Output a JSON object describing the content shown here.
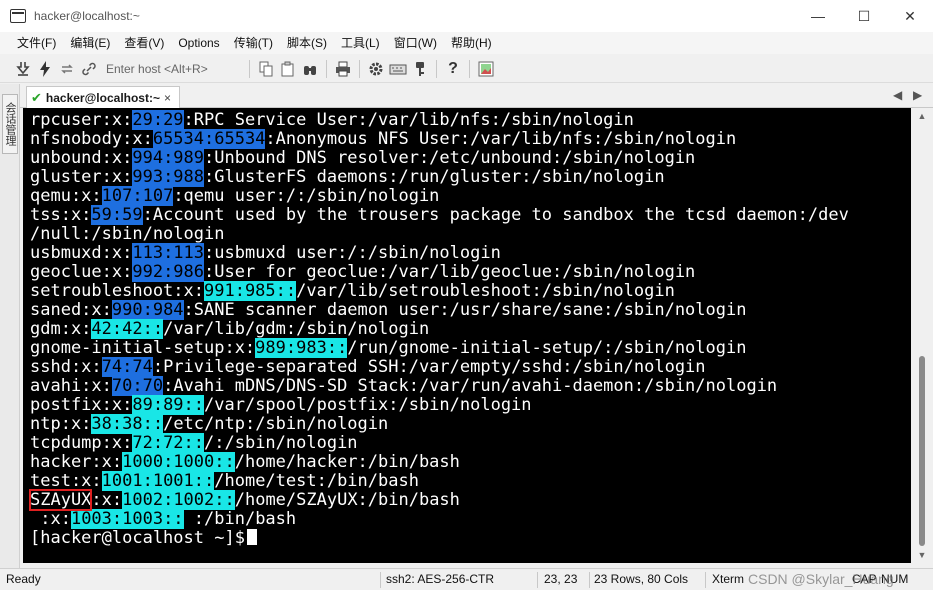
{
  "window": {
    "title": "hacker@localhost:~",
    "controls": {
      "minimize": "—",
      "maximize": "☐",
      "close": "✕"
    }
  },
  "menu": {
    "items": [
      "文件(F)",
      "编辑(E)",
      "查看(V)",
      "Options",
      "传输(T)",
      "脚本(S)",
      "工具(L)",
      "窗口(W)",
      "帮助(H)"
    ]
  },
  "toolbar": {
    "host_placeholder": "Enter host <Alt+R>",
    "icons": [
      "connect-icon",
      "lightning-icon",
      "reconnect-icon",
      "link-icon",
      "copy-icon",
      "paste-icon",
      "find-icon",
      "print-icon",
      "settings-icon",
      "keymap-icon",
      "key-icon",
      "help-icon",
      "image-icon"
    ]
  },
  "side_panel": {
    "label": "会话管理"
  },
  "tab": {
    "label": "hacker@localhost:~",
    "close": "×"
  },
  "terminal": {
    "lines": [
      [
        {
          "t": "rpcuser:x:"
        },
        {
          "t": "29:29",
          "h": "blue"
        },
        {
          "t": ":RPC Service User:/var/lib/nfs:/sbin/nologin"
        }
      ],
      [
        {
          "t": "nfsnobody:x:"
        },
        {
          "t": "65534:65534",
          "h": "blue"
        },
        {
          "t": ":Anonymous NFS User:/var/lib/nfs:/sbin/nologin"
        }
      ],
      [
        {
          "t": "unbound:x:"
        },
        {
          "t": "994:989",
          "h": "blue"
        },
        {
          "t": ":Unbound DNS resolver:/etc/unbound:/sbin/nologin"
        }
      ],
      [
        {
          "t": "gluster:x:"
        },
        {
          "t": "993:988",
          "h": "blue"
        },
        {
          "t": ":GlusterFS daemons:/run/gluster:/sbin/nologin"
        }
      ],
      [
        {
          "t": "qemu:x:"
        },
        {
          "t": "107:107",
          "h": "blue"
        },
        {
          "t": ":qemu user:/:/sbin/nologin"
        }
      ],
      [
        {
          "t": "tss:x:"
        },
        {
          "t": "59:59",
          "h": "blue"
        },
        {
          "t": ":Account used by the trousers package to sandbox the tcsd daemon:/dev"
        }
      ],
      [
        {
          "t": "/null:/sbin/nologin"
        }
      ],
      [
        {
          "t": "usbmuxd:x:"
        },
        {
          "t": "113:113",
          "h": "blue"
        },
        {
          "t": ":usbmuxd user:/:/sbin/nologin"
        }
      ],
      [
        {
          "t": "geoclue:x:"
        },
        {
          "t": "992:986",
          "h": "blue"
        },
        {
          "t": ":User for geoclue:/var/lib/geoclue:/sbin/nologin"
        }
      ],
      [
        {
          "t": "setroubleshoot:x:"
        },
        {
          "t": "991:985::",
          "h": "cyan"
        },
        {
          "t": "/var/lib/setroubleshoot:/sbin/nologin"
        }
      ],
      [
        {
          "t": "saned:x:"
        },
        {
          "t": "990:984",
          "h": "blue"
        },
        {
          "t": ":SANE scanner daemon user:/usr/share/sane:/sbin/nologin"
        }
      ],
      [
        {
          "t": "gdm:x:"
        },
        {
          "t": "42:42::",
          "h": "cyan"
        },
        {
          "t": "/var/lib/gdm:/sbin/nologin"
        }
      ],
      [
        {
          "t": "gnome-initial-setup:x:"
        },
        {
          "t": "989:983::",
          "h": "cyan"
        },
        {
          "t": "/run/gnome-initial-setup/:/sbin/nologin"
        }
      ],
      [
        {
          "t": "sshd:x:"
        },
        {
          "t": "74:74",
          "h": "blue"
        },
        {
          "t": ":Privilege-separated SSH:/var/empty/sshd:/sbin/nologin"
        }
      ],
      [
        {
          "t": "avahi:x:"
        },
        {
          "t": "70:70",
          "h": "blue"
        },
        {
          "t": ":Avahi mDNS/DNS-SD Stack:/var/run/avahi-daemon:/sbin/nologin"
        }
      ],
      [
        {
          "t": "postfix:x:"
        },
        {
          "t": "89:89::",
          "h": "cyan"
        },
        {
          "t": "/var/spool/postfix:/sbin/nologin"
        }
      ],
      [
        {
          "t": "ntp:x:"
        },
        {
          "t": "38:38::",
          "h": "cyan"
        },
        {
          "t": "/etc/ntp:/sbin/nologin"
        }
      ],
      [
        {
          "t": "tcpdump:x:"
        },
        {
          "t": "72:72::",
          "h": "cyan"
        },
        {
          "t": "/:/sbin/nologin"
        }
      ],
      [
        {
          "t": "hacker:x:"
        },
        {
          "t": "1000:1000::",
          "h": "cyan"
        },
        {
          "t": "/home/hacker:/bin/bash"
        }
      ],
      [
        {
          "t": "test:x:"
        },
        {
          "t": "1001:1001::",
          "h": "cyan"
        },
        {
          "t": "/home/test:/bin/bash"
        }
      ],
      [
        {
          "t": "SZAyUX",
          "box": true
        },
        {
          "t": ":x:"
        },
        {
          "t": "1002:1002::",
          "h": "cyan"
        },
        {
          "t": "/home/SZAyUX:/bin/bash"
        }
      ],
      [
        {
          "t": " :x:"
        },
        {
          "t": "1003:1003::",
          "h": "cyan"
        },
        {
          "t": " :/bin/bash"
        }
      ],
      [
        {
          "t": "[hacker@localhost ~]$"
        },
        {
          "cursor": true
        }
      ]
    ]
  },
  "status": {
    "ready": "Ready",
    "cipher": "ssh2: AES-256-CTR",
    "position": "23,  23",
    "size": "23 Rows, 80 Cols",
    "emulation": "Xterm",
    "caps": "CAP",
    "num": "NUM",
    "watermark": "CSDN @Skylar_Huang"
  }
}
